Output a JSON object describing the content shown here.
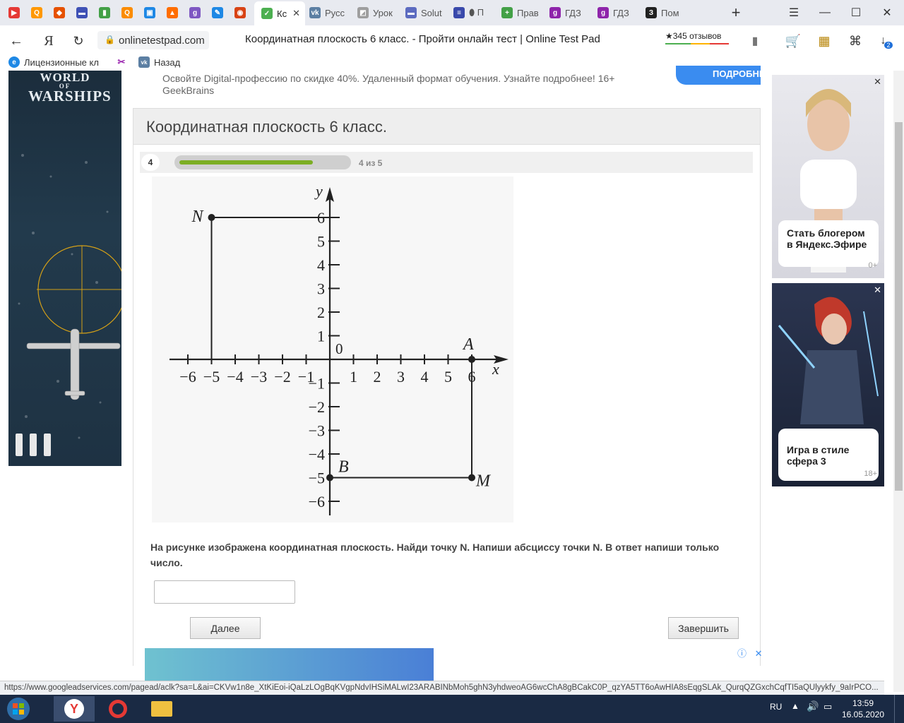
{
  "browser": {
    "tabs": [
      {
        "title": "",
        "color": "#e53935",
        "glyph": "▶"
      },
      {
        "title": "",
        "color": "#ff9800",
        "glyph": "Q"
      },
      {
        "title": "",
        "color": "#e65100",
        "glyph": "◆"
      },
      {
        "title": "",
        "color": "#3f51b5",
        "glyph": "▬"
      },
      {
        "title": "",
        "color": "#43a047",
        "glyph": "▮"
      },
      {
        "title": "",
        "color": "#fb8c00",
        "glyph": "Q"
      },
      {
        "title": "",
        "color": "#1e88e5",
        "glyph": "▣"
      },
      {
        "title": "",
        "color": "#ff6d00",
        "glyph": "▲"
      },
      {
        "title": "",
        "color": "#7e57c2",
        "glyph": "g"
      },
      {
        "title": "",
        "color": "#1e88e5",
        "glyph": "✎"
      },
      {
        "title": "",
        "color": "#d84315",
        "glyph": "◉"
      },
      {
        "title": "Кс",
        "color": "#4caf50",
        "glyph": "✓",
        "active": true
      },
      {
        "title": "Русс",
        "color": "#5c7fa3",
        "glyph": "vk"
      },
      {
        "title": "Урок",
        "color": "#9e9e9e",
        "glyph": "◩"
      },
      {
        "title": "Solut",
        "color": "#5c6bc0",
        "glyph": "▬"
      },
      {
        "title": "⬮ П",
        "color": "#3949ab",
        "glyph": "≡"
      },
      {
        "title": "Прав",
        "color": "#43a047",
        "glyph": "+"
      },
      {
        "title": "ГДЗ",
        "color": "#8e24aa",
        "glyph": "g"
      },
      {
        "title": "ГДЗ",
        "color": "#8e24aa",
        "glyph": "g"
      },
      {
        "title": "Пом",
        "color": "#212121",
        "glyph": "З"
      }
    ],
    "url": "onlinetestpad.com",
    "page_title": "Координатная плоскость 6 класс. - Пройти онлайн тест | Online Test Pad",
    "reviews": "★345 отзывов",
    "download_badge": "2",
    "bookmarks": [
      {
        "label": "Лицензионные кл",
        "color": "#1e88e5",
        "glyph": "e"
      },
      {
        "label": "",
        "color": "#9c27b0",
        "glyph": "✂"
      },
      {
        "label": "Назад",
        "color": "#5c7fa3",
        "glyph": "vk"
      }
    ],
    "status_url": "https://www.googleadservices.com/pagead/aclk?sa=L&ai=CKVw1n8e_XtKiEoi-iQaLzLOgBqKVgpNdvIHSiMALwI23ARABINbMoh5ghN3yhdweoAG6wcChA8gBCakC0P_qzYA5TT6oAwHIA8sEqgSLAk_QurqQZGxchCqfTI5aQUlyykfy_9aIrPCO..."
  },
  "left_ad": {
    "logo_line1": "WORLD",
    "logo_line2": "OF",
    "logo_line3": "WARSHIPS"
  },
  "top_banner": {
    "text": "Освойте Digital-профессию по скидке 40%. Удаленный формат обучения. Узнайте подробнее! 16+",
    "brand": "GeekBrains",
    "button": "ПОДРОБНЕЕ"
  },
  "test": {
    "title": "Координатная плоскость 6 класс.",
    "question_number": "4",
    "progress_label": "4 из 5",
    "progress_fraction": 0.8,
    "question_text": "На рисунке изображена координатная плоскость. Найди точку N. Напиши абсциссу точки N. В ответ напиши только число.",
    "answer_value": "",
    "next_button": "Далее",
    "finish_button": "Завершить"
  },
  "figure": {
    "x_axis_label": "x",
    "y_axis_label": "y",
    "origin_label": "0",
    "x_ticks": [
      "−6",
      "−5",
      "−4",
      "−3",
      "−2",
      "−1",
      "1",
      "2",
      "3",
      "4",
      "5",
      "6"
    ],
    "y_ticks": [
      "6",
      "5",
      "4",
      "3",
      "2",
      "1",
      "−1",
      "−2",
      "−3",
      "−4",
      "−5",
      "−6"
    ],
    "points": [
      {
        "label": "N",
        "x": -5,
        "y": 6
      },
      {
        "label": "A",
        "x": 6,
        "y": 0
      },
      {
        "label": "M",
        "x": 6,
        "y": -5
      },
      {
        "label": "B",
        "x": 0,
        "y": -5
      }
    ]
  },
  "right_ads": [
    {
      "title": "Стать блогером в Яндекс.Эфире",
      "age": "0+"
    },
    {
      "title": "Игра в стиле сфера 3",
      "age": "18+"
    }
  ],
  "taskbar": {
    "language": "RU",
    "time": "13:59",
    "date": "16.05.2020"
  }
}
